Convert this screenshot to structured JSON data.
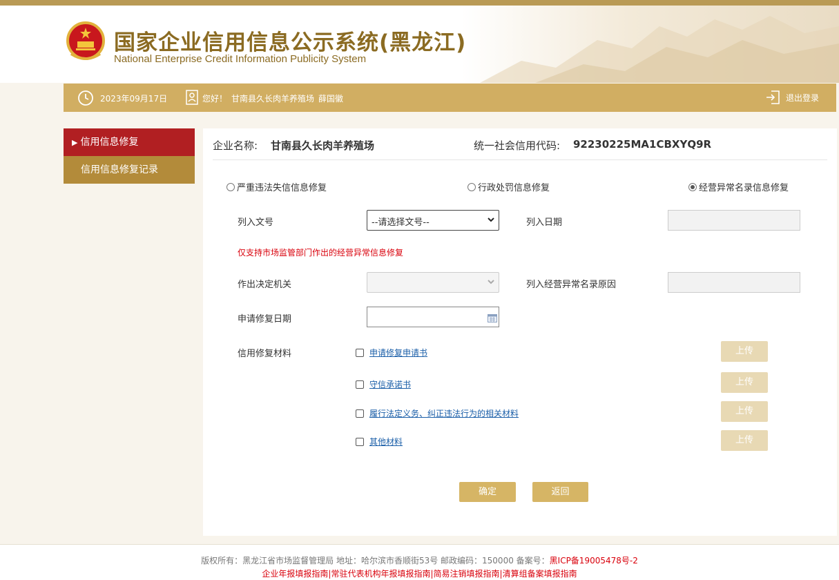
{
  "header": {
    "title_cn": "国家企业信用信息公示系统(黑龙江)",
    "title_en": "National Enterprise Credit Information Publicity System"
  },
  "infobar": {
    "date": "2023年09月17日",
    "greeting": "您好！",
    "company": "甘南县久长肉羊养殖场",
    "user": "薛国徽",
    "logout": "退出登录"
  },
  "sidebar": {
    "items": [
      {
        "label": "信用信息修复"
      },
      {
        "label": "信用信息修复记录"
      }
    ]
  },
  "company_info": {
    "name_label": "企业名称:",
    "name": "甘南县久长肉羊养殖场",
    "code_label": "统一社会信用代码:",
    "code": "92230225MA1CBXYQ9R"
  },
  "repair_types": [
    {
      "label": "严重违法失信信息修复",
      "selected": false
    },
    {
      "label": "行政处罚信息修复",
      "selected": false
    },
    {
      "label": "经营异常名录信息修复",
      "selected": true
    }
  ],
  "form": {
    "doc_no_label": "列入文号",
    "doc_no_value": "--请选择文号--",
    "list_date_label": "列入日期",
    "warning": "仅支持市场监管部门作出的经营异常信息修复",
    "authority_label": "作出决定机关",
    "reason_label": "列入经营异常名录原因",
    "apply_date_label": "申请修复日期",
    "materials_label": "信用修复材料"
  },
  "materials": [
    {
      "label": "申请修复申请书",
      "upload": "上传"
    },
    {
      "label": "守信承诺书",
      "upload": "上传"
    },
    {
      "label": "履行法定义务、纠正违法行为的相关材料",
      "upload": "上传"
    },
    {
      "label": "其他材料",
      "upload": "上传"
    }
  ],
  "actions": {
    "confirm": "确定",
    "back": "返回"
  },
  "footer": {
    "copyright": "版权所有：黑龙江省市场监督管理局 地址：哈尔滨市香顺街53号 邮政编码：150000 备案号：",
    "icp": "黑ICP备19005478号-2",
    "links": [
      "企业年报填报指南",
      "常驻代表机构年报填报指南",
      "简易注销填报指南",
      "清算组备案填报指南"
    ]
  },
  "colors": {
    "brand_gold": "#d1ae62",
    "active_red": "#b11f22",
    "warning_red": "#d9000b"
  }
}
